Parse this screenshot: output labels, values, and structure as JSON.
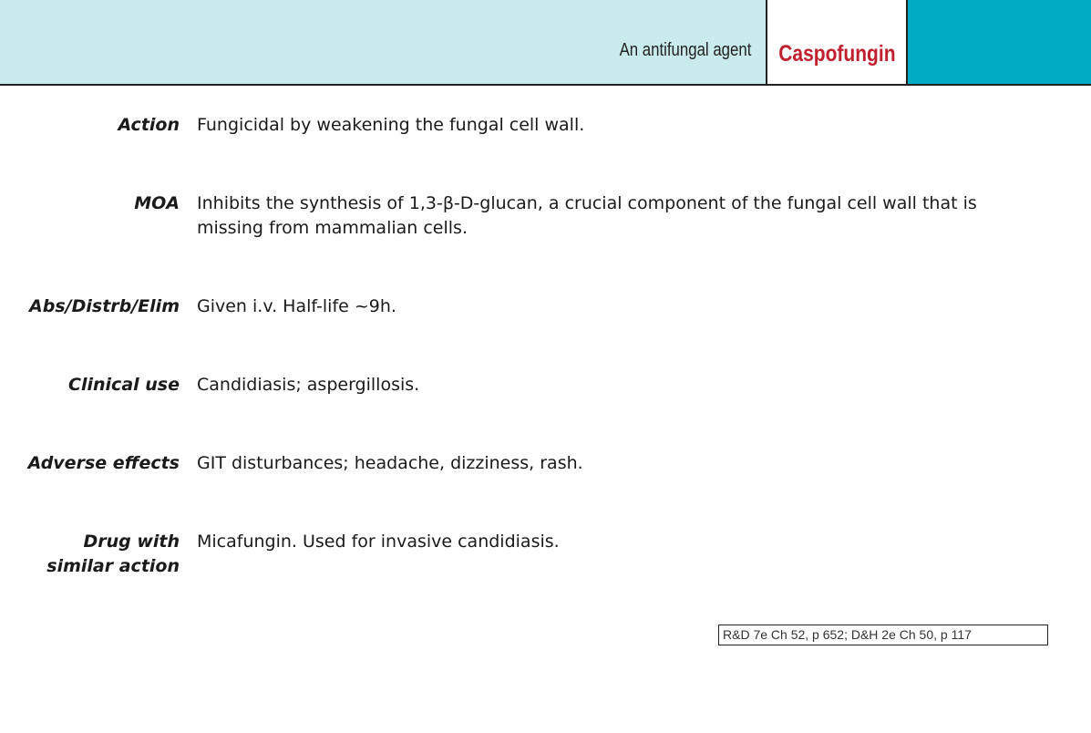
{
  "header": {
    "subtitle": "An antifungal agent",
    "title": "Caspofungin",
    "colors": {
      "band": "#c9ebed",
      "accent": "#00abc2",
      "title": "#c0202e"
    }
  },
  "entries": [
    {
      "label": "Action",
      "value": "Fungicidal by weakening the fungal cell wall."
    },
    {
      "label": "MOA",
      "value": "Inhibits the synthesis of 1,3-β-D-glucan, a crucial component of the fungal cell wall that is missing from mammalian cells."
    },
    {
      "label": "Abs/Distrb/Elim",
      "value": "Given i.v. Half-life ~9h."
    },
    {
      "label": "Clinical use",
      "value": "Candidiasis; aspergillosis."
    },
    {
      "label": "Adverse effects",
      "value": "GIT disturbances; headache, dizziness, rash."
    },
    {
      "label": "Drug with\nsimilar action",
      "value": "Micafungin. Used for invasive candidiasis."
    }
  ],
  "reference": "R&D 7e Ch 52, p 652; D&H 2e Ch 50, p 117"
}
